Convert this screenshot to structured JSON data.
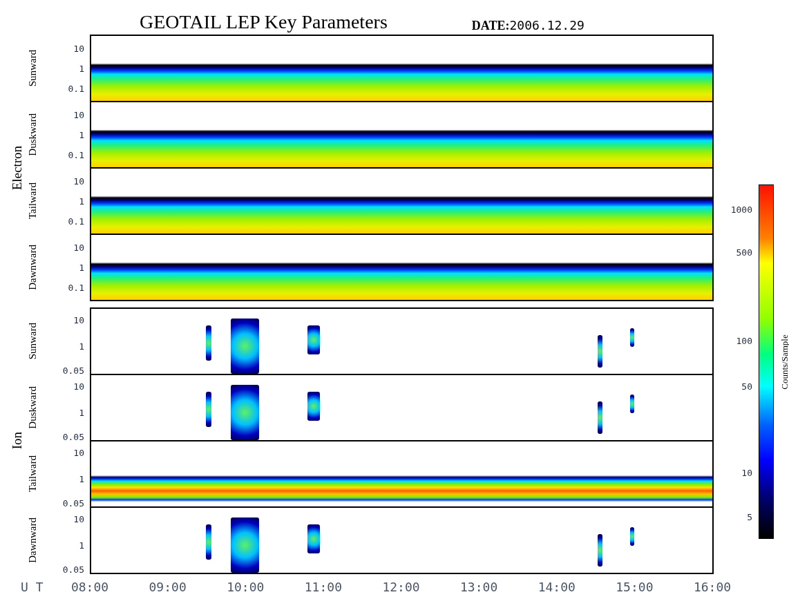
{
  "title": "GEOTAIL LEP Key Parameters",
  "date": {
    "label": "DATE:",
    "value": "2006.12.29"
  },
  "groups": [
    {
      "label": "Electron",
      "panels": [
        {
          "label": "Sunward",
          "kind": "electron",
          "yticks": [
            "10",
            "1",
            "0.1"
          ]
        },
        {
          "label": "Duskward",
          "kind": "electron",
          "yticks": [
            "10",
            "1",
            "0.1"
          ]
        },
        {
          "label": "Tailward",
          "kind": "electron",
          "yticks": [
            "10",
            "1",
            "0.1"
          ]
        },
        {
          "label": "Dawnward",
          "kind": "electron",
          "yticks": [
            "10",
            "1",
            "0.1"
          ]
        }
      ]
    },
    {
      "label": "Ion",
      "panels": [
        {
          "label": "Sunward",
          "kind": "sparse",
          "yticks": [
            "10",
            "1",
            "0.05"
          ]
        },
        {
          "label": "Duskward",
          "kind": "sparse",
          "yticks": [
            "10",
            "1",
            "0.05"
          ]
        },
        {
          "label": "Tailward",
          "kind": "band",
          "yticks": [
            "10",
            "1",
            "0.05"
          ]
        },
        {
          "label": "Dawnward",
          "kind": "sparse",
          "yticks": [
            "10",
            "1",
            "0.05"
          ]
        }
      ]
    }
  ],
  "x_axis": {
    "label": "U T",
    "ticks": [
      "08:00",
      "09:00",
      "10:00",
      "11:00",
      "12:00",
      "13:00",
      "14:00",
      "15:00",
      "16:00"
    ]
  },
  "colorbar": {
    "label": "Counts/Sample",
    "ticks": [
      "1000",
      "500",
      "100",
      "50",
      "10",
      "5"
    ]
  }
}
